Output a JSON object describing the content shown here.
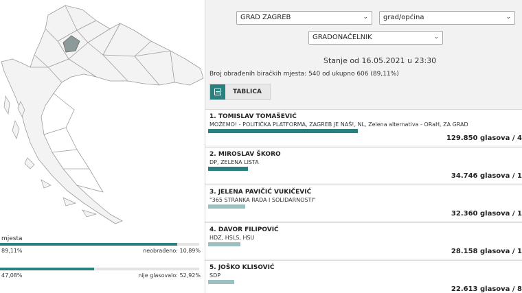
{
  "filters": {
    "region": "GRAD ZAGREB",
    "municipality": "grad/općina",
    "election": "GRADONAČELNIK"
  },
  "stanje": "Stanje od 16.05.2021 u 23:30",
  "broj": "Broj obrađenih biračkih mjesta: 540 od ukupno 606 (89,11%)",
  "tablica_label": "TABLICA",
  "left_stats": {
    "processed_label": "mjesta",
    "processed_pct": "89,11%",
    "unprocessed": "neobrađeno: 10,89%",
    "processed_fraction": 0.8911,
    "turnout_pct": "47,08%",
    "not_voted": "nije glasovalo: 52,92%",
    "turnout_fraction": 0.4708
  },
  "colors": {
    "accent": "#2a7f7f",
    "light": "#9cbfbf",
    "highlight": "#8c9a9a"
  },
  "candidates": [
    {
      "name": "1. TOMISLAV TOMAŠEVIĆ",
      "party": "MOŽEMO! - POLITIČKA PLATFORMA, ZAGREB JE NAŠ!, NL, Zelena alternativa - ORaH, ZA GRAD",
      "votes": "129.850 glasova / 4",
      "share": 0.478,
      "color": "#2a7f7f"
    },
    {
      "name": "2. MIROSLAV ŠKORO",
      "party": "DP, ZELENA LISTA",
      "votes": "34.746 glasova / 1",
      "share": 0.128,
      "color": "#2a7f7f"
    },
    {
      "name": "3. JELENA PAVIČIĆ VUKIČEVIĆ",
      "party": "\"365 STRANKA RADA I SOLIDARNOSTI\"",
      "votes": "32.360 glasova / 1",
      "share": 0.119,
      "color": "#9cbfbf"
    },
    {
      "name": "4. DAVOR FILIPOVIĆ",
      "party": "HDZ, HSLS, HSU",
      "votes": "28.158 glasova / 1",
      "share": 0.104,
      "color": "#9cbfbf"
    },
    {
      "name": "5. JOŠKO KLISOVIĆ",
      "party": "SDP",
      "votes": "22.613 glasova / 8",
      "share": 0.083,
      "color": "#9cbfbf"
    }
  ]
}
